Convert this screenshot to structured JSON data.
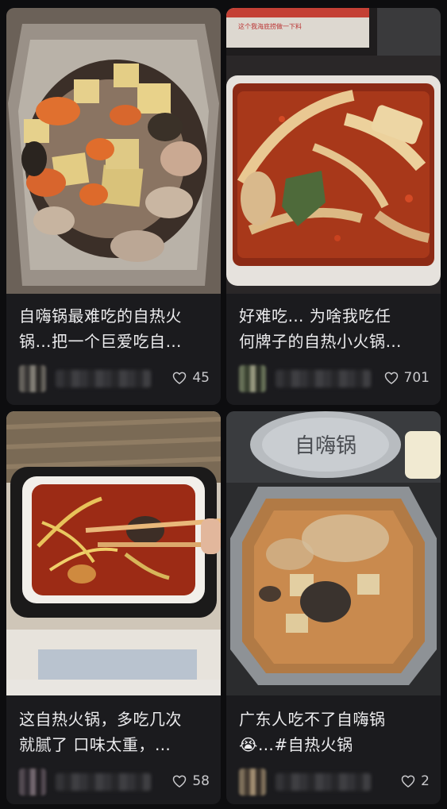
{
  "cards": [
    {
      "title_lines": [
        "自嗨锅最难吃的自热火",
        "锅…把一个巨爱吃自…"
      ],
      "likes": "45",
      "thumb_icon": "tofu-hotpot-photo-icon"
    },
    {
      "title_lines": [
        "好难吃… 为啥我吃任",
        "何牌子的自热小火锅…"
      ],
      "likes": "701",
      "thumb_icon": "spicy-noodle-hotpot-photo-icon",
      "thumb_caption": "这个我海底捞做一下料"
    },
    {
      "title_lines": [
        "这自热火锅，多吃几次",
        "就腻了 口味太重，…"
      ],
      "likes": "58",
      "thumb_icon": "noodle-hotpot-chopsticks-photo-icon"
    },
    {
      "title_lines": [
        "广东人吃不了自嗨锅",
        "😭…#自热火锅"
      ],
      "likes": "2",
      "thumb_icon": "broth-hotpot-photo-icon",
      "lid_text": "自嗨锅"
    }
  ],
  "colors": {
    "background": "#0d0d0f",
    "card": "#1b1b1e",
    "text": "#ececee",
    "likes": "#c9c9cc"
  }
}
